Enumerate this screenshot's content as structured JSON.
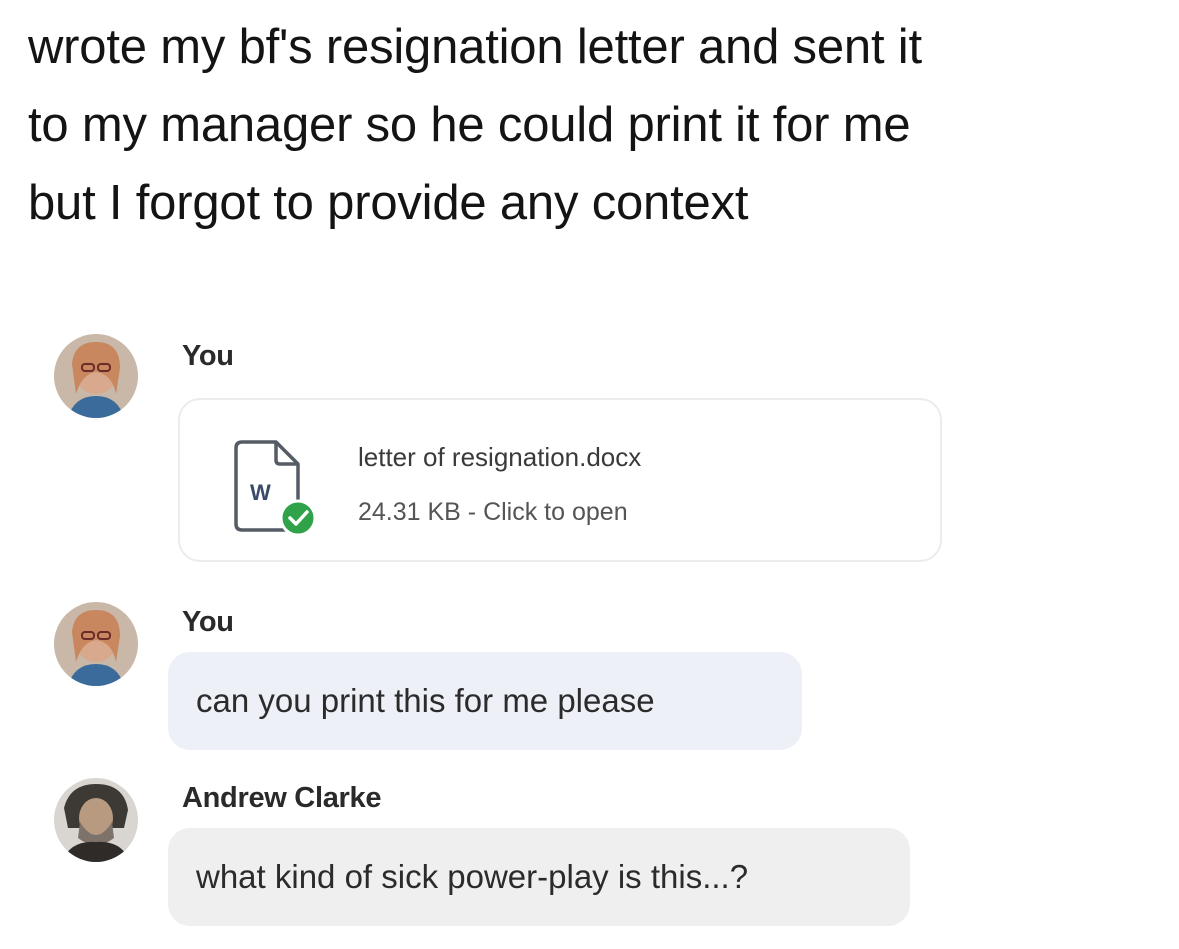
{
  "post": {
    "lines": [
      "wrote my bf's resignation letter and sent it",
      "to my manager so he could print it for me",
      "but I forgot to provide any context"
    ]
  },
  "chat": {
    "messages": [
      {
        "sender": "You",
        "avatar_icon": "user-avatar-icon",
        "attachment": {
          "icon": "word-document-icon",
          "badge_icon": "check-circle-icon",
          "icon_letter": "W",
          "file_name": "letter of resignation.docx",
          "meta": "24.31 KB - Click to open"
        }
      },
      {
        "sender": "You",
        "avatar_icon": "user-avatar-icon",
        "text": "can you print this for me please"
      },
      {
        "sender": "Andrew Clarke",
        "avatar_icon": "contact-avatar-icon",
        "text": "what kind of sick power-play is this...?"
      }
    ]
  },
  "colors": {
    "my_bubble": "#eef0f8",
    "their_bubble": "#efefef",
    "check_badge": "#2fa24a",
    "card_border": "#ececec"
  }
}
